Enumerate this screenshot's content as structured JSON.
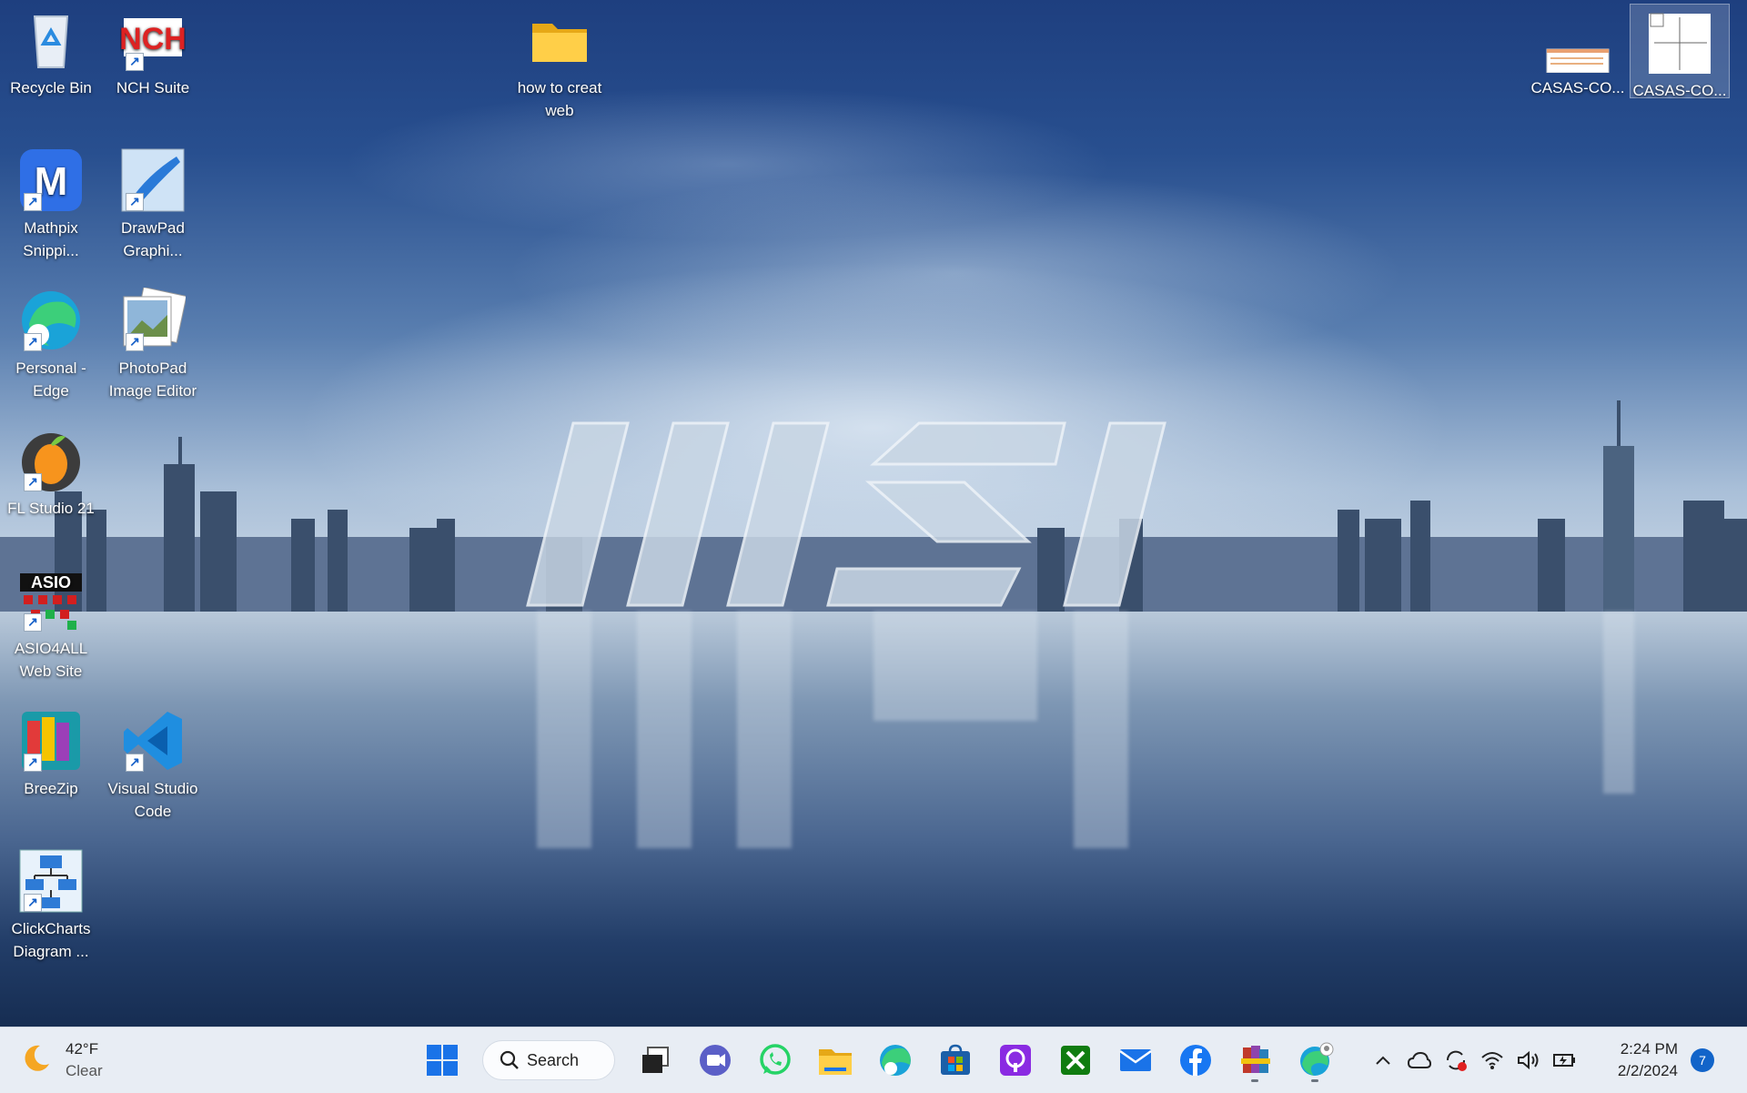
{
  "desktop": {
    "icons": [
      {
        "label": "Recycle Bin",
        "icon": "recycle-bin-icon"
      },
      {
        "label": "NCH Suite",
        "icon": "nch-suite-icon"
      },
      {
        "label": "how to creat web",
        "icon": "folder-icon"
      },
      {
        "label": "CASAS-CO...",
        "icon": "document-thumbnail-icon"
      },
      {
        "label": "CASAS-CO...",
        "icon": "drawing-thumbnail-icon"
      },
      {
        "label": "Mathpix Snippi...",
        "icon": "mathpix-icon"
      },
      {
        "label": "DrawPad Graphi...",
        "icon": "drawpad-icon"
      },
      {
        "label": "Personal - Edge",
        "icon": "edge-profile-icon"
      },
      {
        "label": "PhotoPad Image Editor",
        "icon": "photopad-icon"
      },
      {
        "label": "FL Studio 21",
        "icon": "fl-studio-icon"
      },
      {
        "label": "ASIO4ALL Web Site",
        "icon": "asio4all-icon"
      },
      {
        "label": "BreeZip",
        "icon": "breezip-icon"
      },
      {
        "label": "Visual Studio Code",
        "icon": "vscode-icon"
      },
      {
        "label": "ClickCharts Diagram ...",
        "icon": "clickcharts-icon"
      }
    ]
  },
  "taskbar": {
    "weather": {
      "temp": "42°F",
      "condition": "Clear",
      "icon": "moon-icon"
    },
    "search_label": "Search",
    "apps": [
      "start",
      "search",
      "task-view",
      "teams-meet",
      "whatsapp",
      "file-explorer",
      "edge",
      "microsoft-store",
      "podcast",
      "xbox",
      "mail",
      "facebook",
      "winrar",
      "edge-profile"
    ],
    "tray": {
      "time": "2:24 PM",
      "date": "2/2/2024",
      "notifications": "7"
    }
  },
  "colors": {
    "accent": "#1264c9",
    "taskbar_bg": "#e8edf4"
  }
}
